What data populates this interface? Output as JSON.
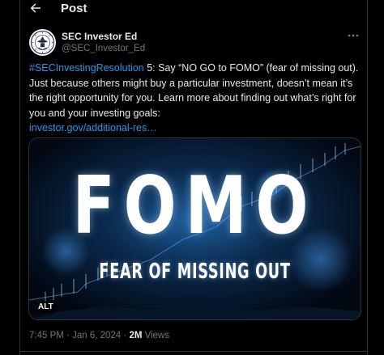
{
  "header": {
    "title": "Post"
  },
  "author": {
    "name": "SEC Investor Ed",
    "handle": "@SEC_Investor_Ed"
  },
  "tweet": {
    "hashtag": "#SECInvestingResolution",
    "body": " 5: Say “NO GO to FOMO” (fear of missing out). Just because others might buy a particular investment, doesn’t mean it’s the right opportunity for you. Learn more about finding out what’s right for you and your investing goals:",
    "link": "investor.gov/additional-res…"
  },
  "media": {
    "title": "FOMO",
    "subtitle": "FEAR OF MISSING OUT",
    "alt_badge": "ALT"
  },
  "meta": {
    "time": "7:45 PM",
    "separator": "·",
    "date": "Jan 6, 2024",
    "views_count": "2M",
    "views_label": "Views"
  },
  "colors": {
    "background": "#000000",
    "text": "#e7e9ea",
    "secondary": "#71767b",
    "link": "#1d9bf0",
    "border": "#2f3336"
  },
  "icons": {
    "back": "arrow-left-icon",
    "more": "more-dots-icon",
    "avatar": "sec-seal-icon"
  }
}
